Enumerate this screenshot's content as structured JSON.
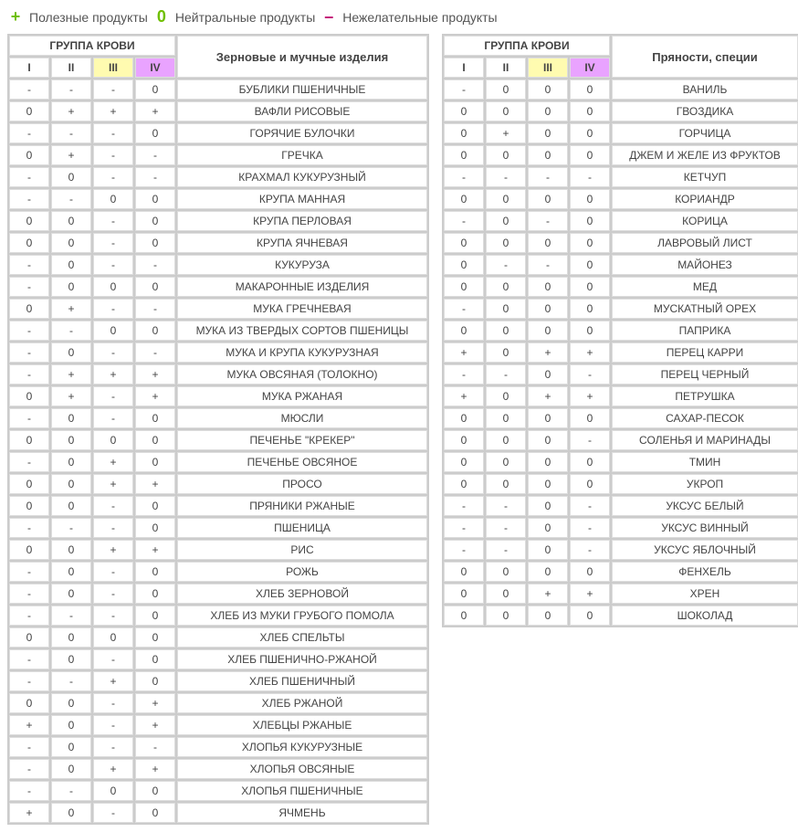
{
  "legend": {
    "plus_label": "Полезные продукты",
    "zero_label": "Нейтральные продукты",
    "minus_label": "Нежелательные продукты"
  },
  "headers": {
    "group": "ГРУППА КРОВИ",
    "i": "I",
    "ii": "II",
    "iii": "III",
    "iv": "IV"
  },
  "left": {
    "title": "Зерновые и мучные изделия",
    "rows": [
      {
        "i": "-",
        "ii": "-",
        "iii": "-",
        "iv": "0",
        "name": "БУБЛИКИ ПШЕНИЧНЫЕ"
      },
      {
        "i": "0",
        "ii": "+",
        "iii": "+",
        "iv": "+",
        "name": "ВАФЛИ РИСОВЫЕ"
      },
      {
        "i": "-",
        "ii": "-",
        "iii": "-",
        "iv": "0",
        "name": "ГОРЯЧИЕ БУЛОЧКИ"
      },
      {
        "i": "0",
        "ii": "+",
        "iii": "-",
        "iv": "-",
        "name": "ГРЕЧКА"
      },
      {
        "i": "-",
        "ii": "0",
        "iii": "-",
        "iv": "-",
        "name": "КРАХМАЛ КУКУРУЗНЫЙ"
      },
      {
        "i": "-",
        "ii": "-",
        "iii": "0",
        "iv": "0",
        "name": "КРУПА МАННАЯ"
      },
      {
        "i": "0",
        "ii": "0",
        "iii": "-",
        "iv": "0",
        "name": "КРУПА ПЕРЛОВАЯ"
      },
      {
        "i": "0",
        "ii": "0",
        "iii": "-",
        "iv": "0",
        "name": "КРУПА ЯЧНЕВАЯ"
      },
      {
        "i": "-",
        "ii": "0",
        "iii": "-",
        "iv": "-",
        "name": "КУКУРУЗА"
      },
      {
        "i": "-",
        "ii": "0",
        "iii": "0",
        "iv": "0",
        "name": "МАКАРОННЫЕ ИЗДЕЛИЯ"
      },
      {
        "i": "0",
        "ii": "+",
        "iii": "-",
        "iv": "-",
        "name": "МУКА ГРЕЧНЕВАЯ"
      },
      {
        "i": "-",
        "ii": "-",
        "iii": "0",
        "iv": "0",
        "name": "МУКА ИЗ ТВЕРДЫХ СОРТОВ ПШЕНИЦЫ"
      },
      {
        "i": "-",
        "ii": "0",
        "iii": "-",
        "iv": "-",
        "name": "МУКА И КРУПА КУКУРУЗНАЯ"
      },
      {
        "i": "-",
        "ii": "+",
        "iii": "+",
        "iv": "+",
        "name": "МУКА ОВСЯНАЯ (ТОЛОКНО)"
      },
      {
        "i": "0",
        "ii": "+",
        "iii": "-",
        "iv": "+",
        "name": "МУКА РЖАНАЯ"
      },
      {
        "i": "-",
        "ii": "0",
        "iii": "-",
        "iv": "0",
        "name": "МЮСЛИ"
      },
      {
        "i": "0",
        "ii": "0",
        "iii": "0",
        "iv": "0",
        "name": "ПЕЧЕНЬЕ \"КРЕКЕР\""
      },
      {
        "i": "-",
        "ii": "0",
        "iii": "+",
        "iv": "0",
        "name": "ПЕЧЕНЬЕ ОВСЯНОЕ"
      },
      {
        "i": "0",
        "ii": "0",
        "iii": "+",
        "iv": "+",
        "name": "ПРОСО"
      },
      {
        "i": "0",
        "ii": "0",
        "iii": "-",
        "iv": "0",
        "name": "ПРЯНИКИ РЖАНЫЕ"
      },
      {
        "i": "-",
        "ii": "-",
        "iii": "-",
        "iv": "0",
        "name": "ПШЕНИЦА"
      },
      {
        "i": "0",
        "ii": "0",
        "iii": "+",
        "iv": "+",
        "name": "РИС"
      },
      {
        "i": "-",
        "ii": "0",
        "iii": "-",
        "iv": "0",
        "name": "РОЖЬ"
      },
      {
        "i": "-",
        "ii": "0",
        "iii": "-",
        "iv": "0",
        "name": "ХЛЕБ ЗЕРНОВОЙ"
      },
      {
        "i": "-",
        "ii": "-",
        "iii": "-",
        "iv": "0",
        "name": "ХЛЕБ ИЗ МУКИ ГРУБОГО ПОМОЛА"
      },
      {
        "i": "0",
        "ii": "0",
        "iii": "0",
        "iv": "0",
        "name": "ХЛЕБ СПЕЛЬТЫ"
      },
      {
        "i": "-",
        "ii": "0",
        "iii": "-",
        "iv": "0",
        "name": "ХЛЕБ ПШЕНИЧНО-РЖАНОЙ"
      },
      {
        "i": "-",
        "ii": "-",
        "iii": "+",
        "iv": "0",
        "name": "ХЛЕБ ПШЕНИЧНЫЙ"
      },
      {
        "i": "0",
        "ii": "0",
        "iii": "-",
        "iv": "+",
        "name": "ХЛЕБ РЖАНОЙ"
      },
      {
        "i": "+",
        "ii": "0",
        "iii": "-",
        "iv": "+",
        "name": "ХЛЕБЦЫ РЖАНЫЕ"
      },
      {
        "i": "-",
        "ii": "0",
        "iii": "-",
        "iv": "-",
        "name": "ХЛОПЬЯ КУКУРУЗНЫЕ"
      },
      {
        "i": "-",
        "ii": "0",
        "iii": "+",
        "iv": "+",
        "name": "ХЛОПЬЯ ОВСЯНЫЕ"
      },
      {
        "i": "-",
        "ii": "-",
        "iii": "0",
        "iv": "0",
        "name": "ХЛОПЬЯ ПШЕНИЧНЫЕ"
      },
      {
        "i": "+",
        "ii": "0",
        "iii": "-",
        "iv": "0",
        "name": "ЯЧМЕНЬ"
      }
    ]
  },
  "right": {
    "title": "Пряности, специи",
    "rows": [
      {
        "i": "-",
        "ii": "0",
        "iii": "0",
        "iv": "0",
        "name": "ВАНИЛЬ"
      },
      {
        "i": "0",
        "ii": "0",
        "iii": "0",
        "iv": "0",
        "name": "ГВОЗДИКА"
      },
      {
        "i": "0",
        "ii": "+",
        "iii": "0",
        "iv": "0",
        "name": "ГОРЧИЦА"
      },
      {
        "i": "0",
        "ii": "0",
        "iii": "0",
        "iv": "0",
        "name": "ДЖЕМ И ЖЕЛЕ ИЗ ФРУКТОВ"
      },
      {
        "i": "-",
        "ii": "-",
        "iii": "-",
        "iv": "-",
        "name": "КЕТЧУП"
      },
      {
        "i": "0",
        "ii": "0",
        "iii": "0",
        "iv": "0",
        "name": "КОРИАНДР"
      },
      {
        "i": "-",
        "ii": "0",
        "iii": "-",
        "iv": "0",
        "name": "КОРИЦА"
      },
      {
        "i": "0",
        "ii": "0",
        "iii": "0",
        "iv": "0",
        "name": "ЛАВРОВЫЙ ЛИСТ"
      },
      {
        "i": "0",
        "ii": "-",
        "iii": "-",
        "iv": "0",
        "name": "МАЙОНЕЗ"
      },
      {
        "i": "0",
        "ii": "0",
        "iii": "0",
        "iv": "0",
        "name": "МЕД"
      },
      {
        "i": "-",
        "ii": "0",
        "iii": "0",
        "iv": "0",
        "name": "МУСКАТНЫЙ ОРЕХ"
      },
      {
        "i": "0",
        "ii": "0",
        "iii": "0",
        "iv": "0",
        "name": "ПАПРИКА"
      },
      {
        "i": "+",
        "ii": "0",
        "iii": "+",
        "iv": "+",
        "name": "ПЕРЕЦ КАРРИ"
      },
      {
        "i": "-",
        "ii": "-",
        "iii": "0",
        "iv": "-",
        "name": "ПЕРЕЦ ЧЕРНЫЙ"
      },
      {
        "i": "+",
        "ii": "0",
        "iii": "+",
        "iv": "+",
        "name": "ПЕТРУШКА"
      },
      {
        "i": "0",
        "ii": "0",
        "iii": "0",
        "iv": "0",
        "name": "САХАР-ПЕСОК"
      },
      {
        "i": "0",
        "ii": "0",
        "iii": "0",
        "iv": "-",
        "name": "СОЛЕНЬЯ И МАРИНАДЫ"
      },
      {
        "i": "0",
        "ii": "0",
        "iii": "0",
        "iv": "0",
        "name": "ТМИН"
      },
      {
        "i": "0",
        "ii": "0",
        "iii": "0",
        "iv": "0",
        "name": "УКРОП"
      },
      {
        "i": "-",
        "ii": "-",
        "iii": "0",
        "iv": "-",
        "name": "УКСУС БЕЛЫЙ"
      },
      {
        "i": "-",
        "ii": "-",
        "iii": "0",
        "iv": "-",
        "name": "УКСУС ВИННЫЙ"
      },
      {
        "i": "-",
        "ii": "-",
        "iii": "0",
        "iv": "-",
        "name": "УКСУС ЯБЛОЧНЫЙ"
      },
      {
        "i": "0",
        "ii": "0",
        "iii": "0",
        "iv": "0",
        "name": "ФЕНХЕЛЬ"
      },
      {
        "i": "0",
        "ii": "0",
        "iii": "+",
        "iv": "+",
        "name": "ХРЕН"
      },
      {
        "i": "0",
        "ii": "0",
        "iii": "0",
        "iv": "0",
        "name": "ШОКОЛАД"
      }
    ]
  }
}
